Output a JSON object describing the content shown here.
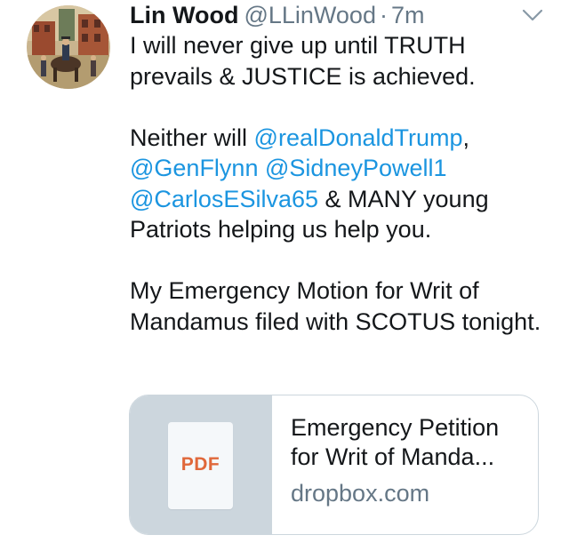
{
  "tweet": {
    "author": {
      "name": "Lin Wood",
      "handle": "@LLinWood",
      "separator": "·",
      "time": "7m"
    },
    "paragraph1": "I will never give up until TRUTH prevails & JUSTICE is achieved.",
    "paragraph2": {
      "lead": "Neither will ",
      "mention1": "@realDonaldTrump",
      "comma": ",",
      "mention2": "@GenFlynn",
      "mention3": "@SidneyPowell1",
      "mention4": "@CarlosESilva65",
      "tail": " & MANY young Patriots helping us help you."
    },
    "paragraph3": "My Emergency Motion for Writ of Mandamus filed with SCOTUS tonight.",
    "card": {
      "thumbnail_label": "PDF",
      "title": "Emergency Petition for Writ of Manda...",
      "domain": "dropbox.com"
    }
  },
  "colors": {
    "link": "#1b95e0",
    "text": "#14171a",
    "muted": "#657786",
    "border": "#ccd6dd",
    "pdf_accent": "#e0683a"
  },
  "icons": {
    "menu": "chevron-down-icon",
    "avatar": "profile-avatar-painting"
  }
}
